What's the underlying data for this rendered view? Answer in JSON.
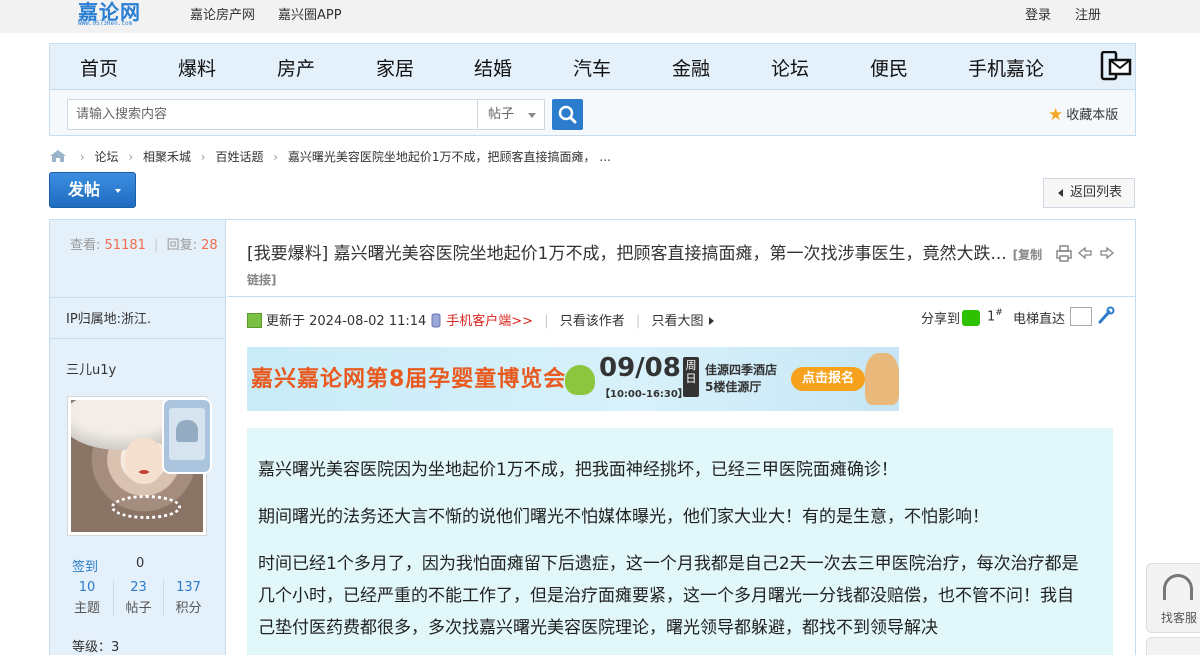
{
  "topbar": {
    "logo_text": "嘉论网",
    "logo_sub": "WWW.0573Ren.com",
    "links": [
      "嘉论房产网",
      "嘉兴圈APP"
    ],
    "login": "登录",
    "register": "注册"
  },
  "nav": {
    "items": [
      "首页",
      "爆料",
      "房产",
      "家居",
      "结婚",
      "汽车",
      "金融",
      "论坛",
      "便民",
      "手机嘉论"
    ]
  },
  "search": {
    "placeholder": "请输入搜索内容",
    "scope": "帖子",
    "favorite": "收藏本版"
  },
  "breadcrumb": {
    "items": [
      "论坛",
      "相聚禾城",
      "百姓话题",
      "嘉兴曙光美容医院坐地起价1万不成，把顾客直接搞面瘫， ..."
    ]
  },
  "actions": {
    "post": "发帖",
    "back": "返回列表"
  },
  "sidebar": {
    "views_label": "查看:",
    "views": "51181",
    "replies_label": "回复:",
    "replies": "28",
    "ip_location": "IP归属地:浙江.",
    "username": "三儿u1y",
    "signin_label": "签到",
    "signin_value": "0",
    "stats": [
      {
        "value": "10",
        "label": "主题"
      },
      {
        "value": "23",
        "label": "帖子"
      },
      {
        "value": "137",
        "label": "积分"
      }
    ],
    "level": "等级：3"
  },
  "thread": {
    "title": "[我要爆料] 嘉兴曙光美容医院坐地起价1万不成，把顾客直接搞面瘫，第一次找涉事医生，竟然大跌...",
    "copy_link": "[复制链接]"
  },
  "meta": {
    "updated": "更新于 2024-08-02 11:14",
    "mobile_client": "手机客户端>>",
    "only_author": "只看该作者",
    "big_images": "只看大图",
    "share": "分享到",
    "floor": "1",
    "floor_suffix": "#",
    "elevator": "电梯直达"
  },
  "banner": {
    "title": "嘉兴嘉论网第8届孕婴童博览会",
    "date": "09/08",
    "time": "【10:00-16:30】",
    "day": "周日",
    "venue_line1": "佳源四季酒店",
    "venue_line2": "5楼佳源厅",
    "cta": "点击报名"
  },
  "post": {
    "paragraphs": [
      "嘉兴曙光美容医院因为坐地起价1万不成，把我面神经挑坏，已经三甲医院面瘫确诊！",
      "期间曙光的法务还大言不惭的说他们曙光不怕媒体曝光，他们家大业大！有的是生意，不怕影响！",
      "时间已经1个多月了，因为我怕面瘫留下后遗症，这一个月我都是自己2天一次去三甲医院治疗，每次治疗都是几个小时，已经严重的不能工作了，但是治疗面瘫要紧，这一个多月曙光一分钱都没赔偿，也不管不问！我自己垫付医药费都很多，多次找嘉兴曙光美容医院理论，曙光领导都躲避，都找不到领导解决"
    ]
  },
  "service": {
    "label": "找客服"
  },
  "colors": {
    "accent": "#2b7ccc",
    "nav_bg": "#e4f0fa",
    "border": "#c6dcef",
    "highlight": "#f26c4f",
    "post_bg": "#e1f7f9"
  }
}
